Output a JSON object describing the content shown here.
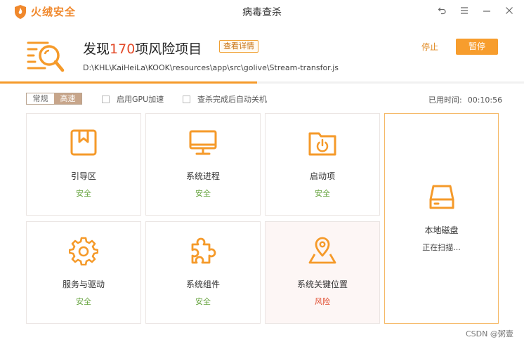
{
  "app": {
    "brand": "火绒安全",
    "window_title": "病毒查杀"
  },
  "scan": {
    "headline_prefix": "发现",
    "risk_count": "170",
    "headline_suffix": "项风险项目",
    "details_label": "查看详情",
    "current_path": "D:\\KHL\\KaiHeiLa\\KOOK\\resources\\app\\src\\golive\\Stream-transfor.js",
    "stop_label": "停止",
    "pause_label": "暂停",
    "progress": 0.49
  },
  "options": {
    "speed_normal": "常规",
    "speed_fast": "高速",
    "speed_selected": "高速",
    "gpu_label": "启用GPU加速",
    "gpu_checked": false,
    "shutdown_label": "查杀完成后自动关机",
    "shutdown_checked": false,
    "elapsed_label": "已用时间:",
    "elapsed_value": "00:10:56"
  },
  "tiles": [
    {
      "label": "引导区",
      "status": "安全",
      "icon": "bookmark-box-icon"
    },
    {
      "label": "系统进程",
      "status": "安全",
      "icon": "monitor-icon"
    },
    {
      "label": "启动项",
      "status": "安全",
      "icon": "power-folder-icon"
    },
    {
      "label": "服务与驱动",
      "status": "安全",
      "icon": "gear-icon"
    },
    {
      "label": "系统组件",
      "status": "安全",
      "icon": "puzzle-icon"
    },
    {
      "label": "系统关键位置",
      "status": "风险",
      "icon": "map-pin-icon"
    },
    {
      "label": "本地磁盘",
      "status": "正在扫描...",
      "icon": "hard-disk-icon"
    }
  ],
  "watermark": "CSDN @粥壹",
  "colors": {
    "accent": "#f59a2a",
    "safe": "#64a23c",
    "risk": "#e0492b",
    "risk_count": "#e34b2a"
  }
}
